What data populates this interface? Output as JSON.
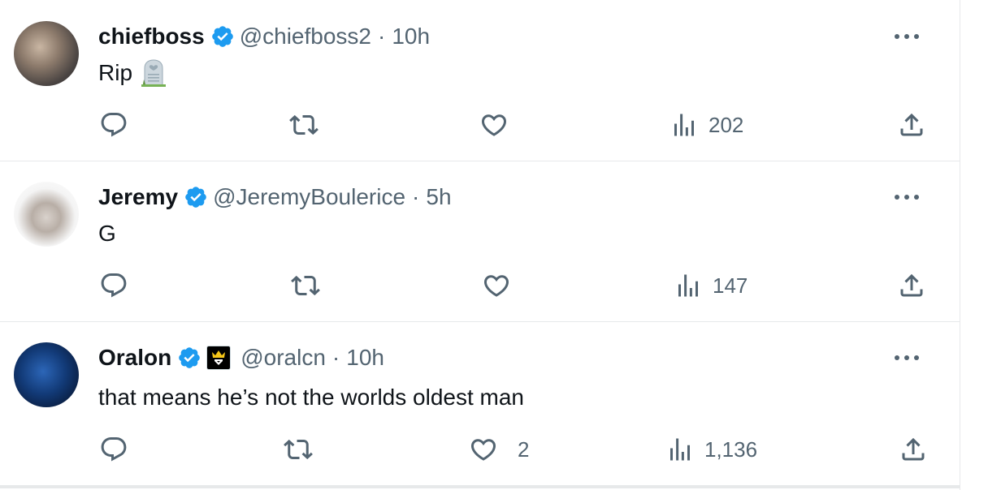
{
  "tweets": [
    {
      "name": "chiefboss",
      "handle": "@chiefboss2",
      "separator": "·",
      "time": "10h",
      "text": "Rip",
      "emoji": "headstone",
      "likes": "",
      "views": "202"
    },
    {
      "name": "Jeremy",
      "handle": "@JeremyBoulerice",
      "separator": "·",
      "time": "5h",
      "text": "G",
      "emoji": "",
      "likes": "",
      "views": "147"
    },
    {
      "name": "Oralon",
      "handle": "@oralcn",
      "separator": "·",
      "time": "10h",
      "text": "that means he’s not the worlds oldest man",
      "emoji": "",
      "likes": "2",
      "views": "1,136"
    }
  ],
  "icons": {
    "verified": "verified-badge-icon",
    "affiliate": "crown-badge-icon",
    "more": "more-icon",
    "reply": "reply-icon",
    "retweet": "retweet-icon",
    "like": "like-icon",
    "views": "views-icon",
    "share": "share-icon"
  },
  "colors": {
    "verified": "#1d9bf0",
    "secondary_text": "#536471",
    "primary_text": "#0f1419",
    "divider": "#e7e9ea"
  }
}
